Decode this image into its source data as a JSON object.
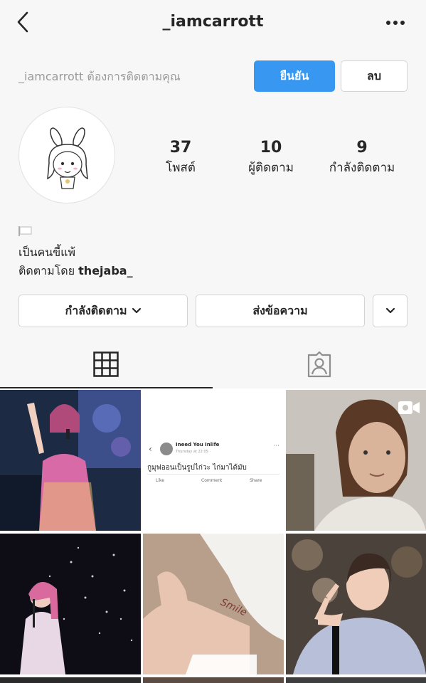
{
  "header": {
    "username": "_iamcarrott"
  },
  "request": {
    "text": "_iamcarrott ต้องการติดตามคุณ",
    "confirm_label": "ยืนยัน",
    "delete_label": "ลบ"
  },
  "stats": [
    {
      "value": "37",
      "label": "โพสต์"
    },
    {
      "value": "10",
      "label": "ผู้ติดตาม"
    },
    {
      "value": "9",
      "label": "กำลังติดตาม"
    }
  ],
  "bio": {
    "line1": "เป็นคนขี้แพ้",
    "followed_by_prefix": "ติดตามโดย",
    "followed_by_user": "thejaba_"
  },
  "actions": {
    "following_label": "กำลังติดตาม",
    "message_label": "ส่งข้อความ"
  },
  "posts": {
    "post2": {
      "author": "Ineed You Inlife",
      "time": "Thursday at 22:05 ·",
      "text": "กูมุฟออนเป็นรูปไก่วะ ไก่มาได้มับ",
      "like": "Like",
      "comment": "Comment",
      "share": "Share"
    },
    "post5_text": "Smile"
  },
  "colors": {
    "accent": "#3897f0",
    "text": "#262626",
    "muted": "#9a9a9a",
    "border": "#d3d3d3"
  }
}
